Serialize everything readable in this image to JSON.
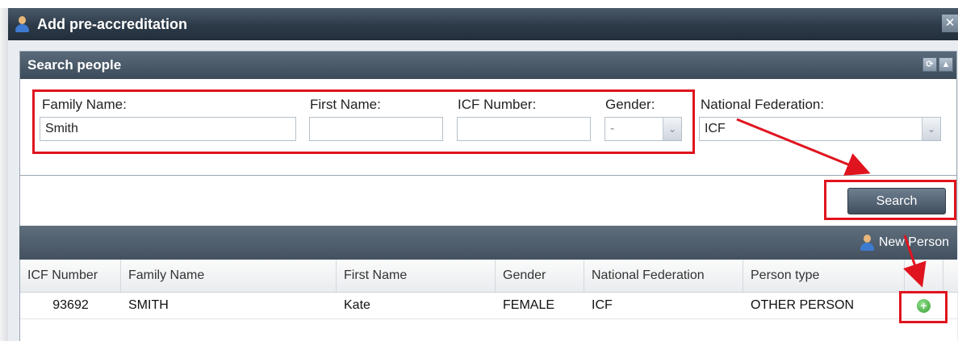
{
  "window": {
    "title": "Add pre-accreditation",
    "close_icon": "close-icon"
  },
  "search_panel": {
    "title": "Search people",
    "fields": {
      "family_name": {
        "label": "Family Name:",
        "value": "Smith"
      },
      "first_name": {
        "label": "First Name:",
        "value": ""
      },
      "icf_number": {
        "label": "ICF Number:",
        "value": ""
      },
      "gender": {
        "label": "Gender:",
        "value": "-"
      },
      "national_federation": {
        "label": "National Federation:",
        "value": "ICF"
      }
    },
    "search_label": "Search"
  },
  "grid": {
    "new_person_label": "New Person",
    "columns": [
      "ICF Number",
      "Family Name",
      "First Name",
      "Gender",
      "National Federation",
      "Person type"
    ],
    "rows": [
      [
        "93692",
        "SMITH",
        "Kate",
        "FEMALE",
        "ICF",
        "OTHER PERSON"
      ]
    ]
  },
  "colors": {
    "annotation": "#e0141e",
    "header": "#3c4b59",
    "add_icon": "#3a9f35"
  }
}
